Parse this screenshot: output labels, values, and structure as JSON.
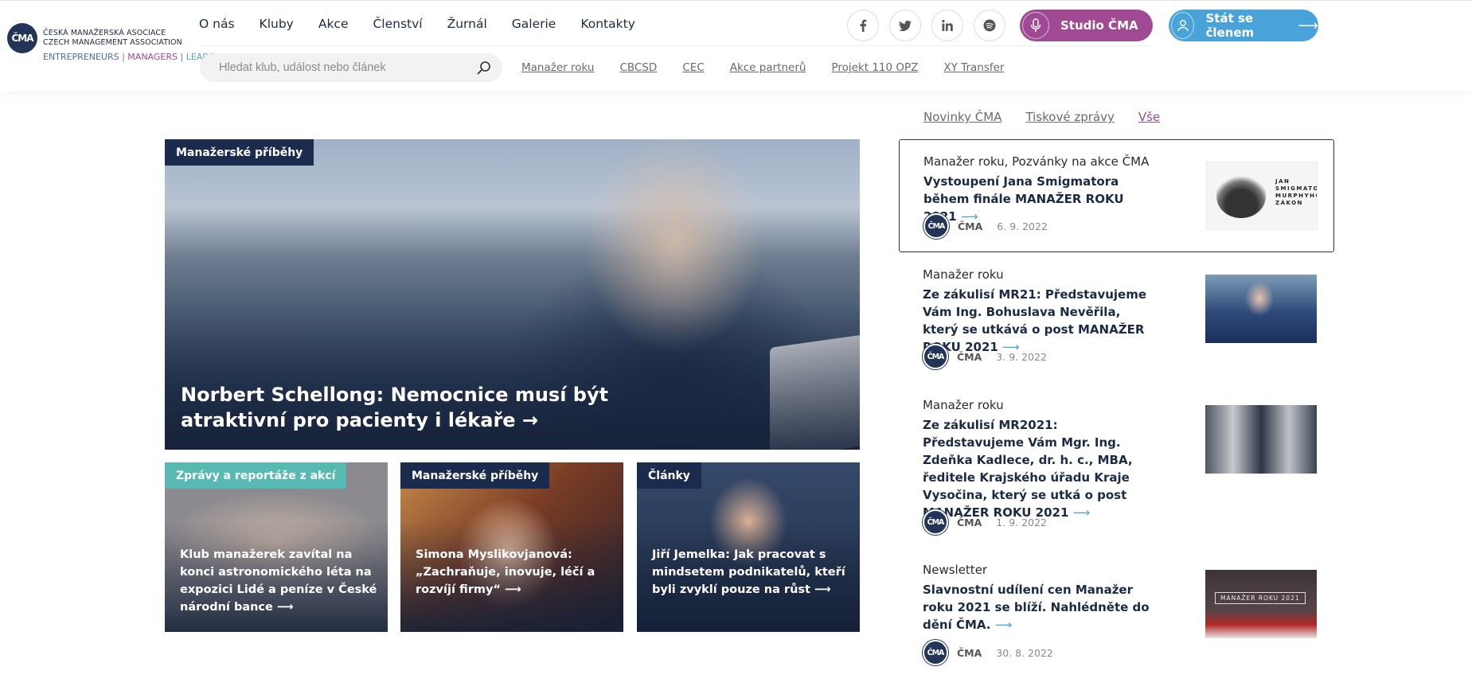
{
  "logo": {
    "mark": "ČMA",
    "line1": "ČESKÁ MANAŽERSKÁ ASOCIACE",
    "line2": "CZECH MANAGEMENT ASSOCIATION",
    "entrepreneurs": "ENTREPRENEURS",
    "managers": "MANAGERS",
    "leaders": "LEADERS",
    "separator": "|"
  },
  "nav": {
    "items": [
      "O nás",
      "Kluby",
      "Akce",
      "Členství",
      "Žurnál",
      "Galerie",
      "Kontakty"
    ]
  },
  "socials": {
    "facebook": "facebook-icon",
    "twitter": "twitter-icon",
    "linkedin": "linkedin-icon",
    "spotify": "spotify-icon"
  },
  "buttons": {
    "studio": "Studio ČMA",
    "member": "Stát se členem",
    "member_arrow": "⟶"
  },
  "search": {
    "placeholder": "Hledat klub, událost nebo článek"
  },
  "subnav": {
    "items": [
      "Manažer roku",
      "CBCSD",
      "CEC",
      "Akce partnerů",
      "Projekt 110 OPZ",
      "XY Transfer"
    ]
  },
  "featured": {
    "tag": "Manažerské příběhy",
    "title": "Norbert Schellong: Nemocnice musí být atraktivní pro pacienty i lékaře →"
  },
  "cards": [
    {
      "tag": "Zprávy a reportáže z akcí",
      "title": "Klub manažerek zavítal na konci astronomického léta na expozici Lidé a peníze v České národní bance ⟶"
    },
    {
      "tag": "Manažerské příběhy",
      "title": "Simona Myslikovjanová: „Zachraňuje, inovuje, léčí a rozvíjí firmy“ ⟶"
    },
    {
      "tag": "Články",
      "title": "Jiří Jemelka: Jak pracovat s mindsetem podnikatelů, kteří byli zvyklí pouze na růst ⟶"
    }
  ],
  "news_tabs": [
    "Novinky ČMA",
    "Tiskové zprávy",
    "Vše"
  ],
  "news": [
    {
      "category": "Manažer roku, Pozvánky na akce ČMA",
      "title": "Vystoupení Jana Smigmatora během finále MANAŽER ROKU 2021",
      "arrow": "⟶",
      "author": "ČMA",
      "date": "6. 9. 2022",
      "thumb_text": "JAN SMIGMATOR MURPHYHO ZÁKON"
    },
    {
      "category": "Manažer roku",
      "title": "Ze zákulisí MR21: Představujeme Vám Ing. Bohuslava Nevěřila, který se utkává o post MANAŽER ROKU 2021",
      "arrow": "⟶",
      "author": "ČMA",
      "date": "3. 9. 2022"
    },
    {
      "category": "Manažer roku",
      "title": "Ze zákulisí MR2021: Představujeme Vám Mgr. Ing. Zdeňka Kadlece, dr. h. c., MBA, ředitele Krajského úřadu Kraje Vysočina, který se utká o post MANAŽER ROKU 2021",
      "arrow": "⟶",
      "author": "ČMA",
      "date": "1. 9. 2022"
    },
    {
      "category": "Newsletter",
      "title": "Slavnostní udílení cen Manažer roku 2021 se blíží. Nahlédněte do dění ČMA.",
      "arrow": "⟶",
      "author": "ČMA",
      "date": "30. 8. 2022",
      "thumb_text": "MANAŽER ROKU 2021"
    }
  ]
}
